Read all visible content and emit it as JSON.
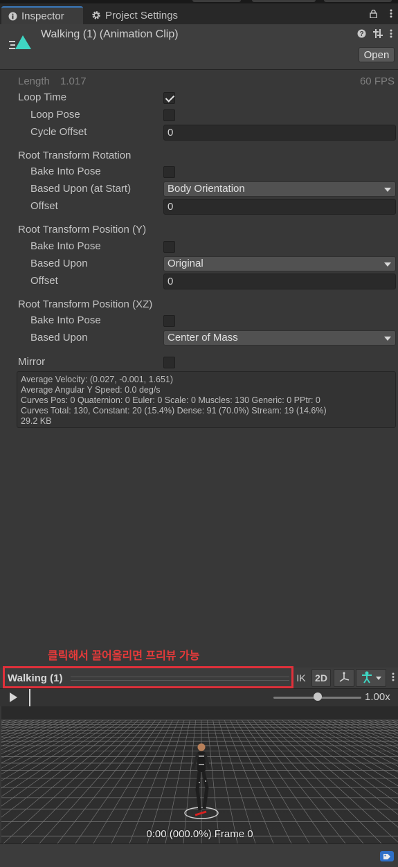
{
  "tabs": [
    {
      "label": "Inspector",
      "icon": "info-icon",
      "active": true
    },
    {
      "label": "Project Settings",
      "icon": "gear-icon",
      "active": false
    }
  ],
  "header": {
    "title": "Walking (1) (Animation Clip)",
    "open_label": "Open"
  },
  "clip": {
    "length_label": "Length",
    "length_value": "1.017",
    "fps": "60 FPS",
    "loop_time": {
      "label": "Loop Time",
      "checked": true
    },
    "loop_pose": {
      "label": "Loop Pose",
      "checked": false
    },
    "cycle_offset": {
      "label": "Cycle Offset",
      "value": "0"
    }
  },
  "root_rotation": {
    "heading": "Root Transform Rotation",
    "bake_label": "Bake Into Pose",
    "based_label": "Based Upon (at Start)",
    "based_value": "Body Orientation",
    "offset_label": "Offset",
    "offset_value": "0"
  },
  "root_position_y": {
    "heading": "Root Transform Position (Y)",
    "bake_label": "Bake Into Pose",
    "based_label": "Based Upon",
    "based_value": "Original",
    "offset_label": "Offset",
    "offset_value": "0"
  },
  "root_position_xz": {
    "heading": "Root Transform Position (XZ)",
    "bake_label": "Bake Into Pose",
    "based_label": "Based Upon",
    "based_value": "Center of Mass"
  },
  "mirror": {
    "label": "Mirror",
    "checked": false
  },
  "stats": [
    "Average Velocity: (0.027, -0.001, 1.651)",
    "Average Angular Y Speed: 0.0 deg/s",
    "Curves Pos: 0 Quaternion: 0 Euler: 0 Scale: 0 Muscles: 130 Generic: 0 PPtr: 0",
    "Curves Total: 130, Constant: 20 (15.4%) Dense: 91 (70.0%) Stream: 19 (14.6%)",
    "29.2 KB"
  ],
  "annotation": "클릭해서 끌어올리면 프리뷰 가능",
  "preview": {
    "title": "Walking (1)",
    "ik_label": "IK",
    "twod_label": "2D",
    "speed": "1.00x",
    "speed_fraction": 0.5,
    "frame_label": "0:00 (000.0%) Frame 0"
  },
  "colors": {
    "accent_blue": "#3a79bb",
    "annotation_red": "#e63a3a",
    "clip_icon": "#3fd6c3",
    "avatar_icon": "#3fd6c3"
  }
}
